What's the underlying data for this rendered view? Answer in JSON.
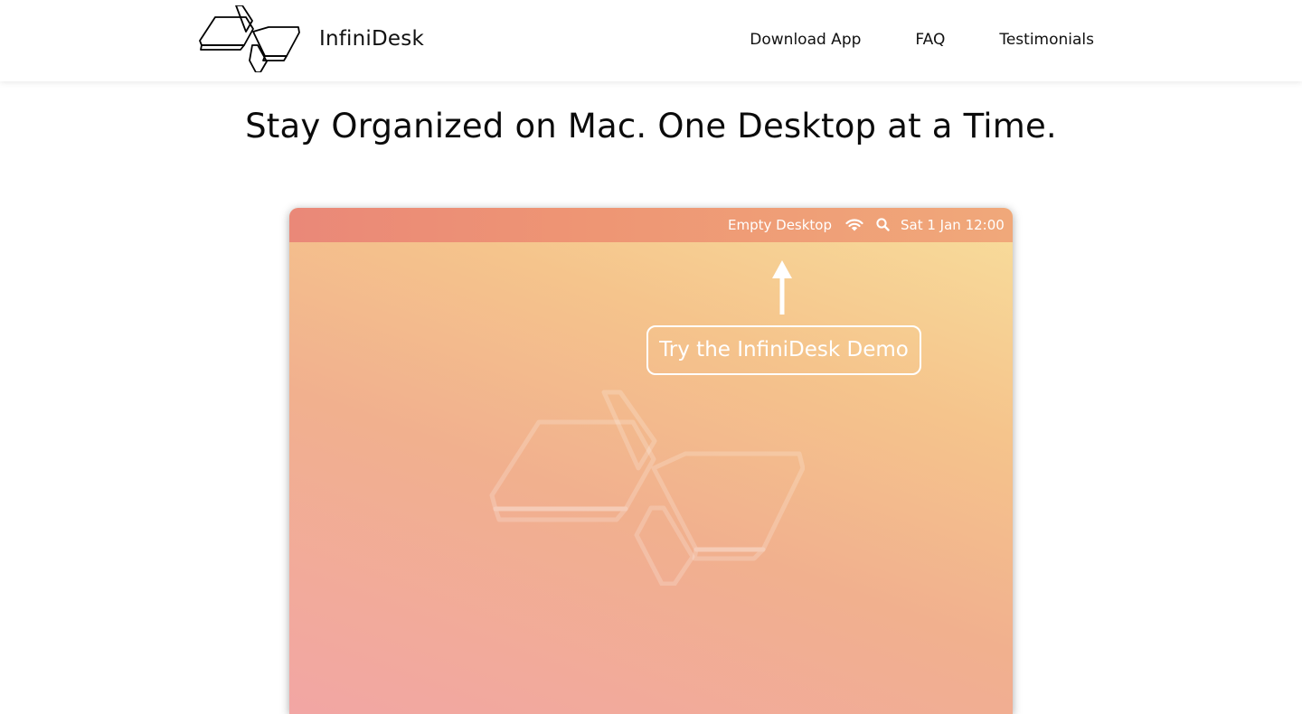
{
  "header": {
    "brand_name": "InfiniDesk",
    "logo_icon": "infinidesk-logo-icon",
    "nav": [
      {
        "label": "Download App"
      },
      {
        "label": "FAQ"
      },
      {
        "label": "Testimonials"
      }
    ]
  },
  "hero": {
    "headline": "Stay Organized on Mac. One Desktop at a Time."
  },
  "demo_window": {
    "menubar": {
      "desktop_name": "Empty Desktop",
      "wifi_icon": "wifi-icon",
      "search_icon": "search-icon",
      "datetime": "Sat 1 Jan 12:00"
    },
    "arrow_icon": "arrow-up-icon",
    "demo_button_label": "Try the InfiniDesk Demo",
    "watermark_icon": "infinidesk-logo-watermark"
  },
  "colors": {
    "menubar_start": "#ea8878",
    "menubar_end": "#f0a87a",
    "wallpaper_top_right": "#f8de9c",
    "wallpaper_bottom_left": "#f2a6a4",
    "text_dark": "#111111",
    "text_light": "#ffffff"
  }
}
